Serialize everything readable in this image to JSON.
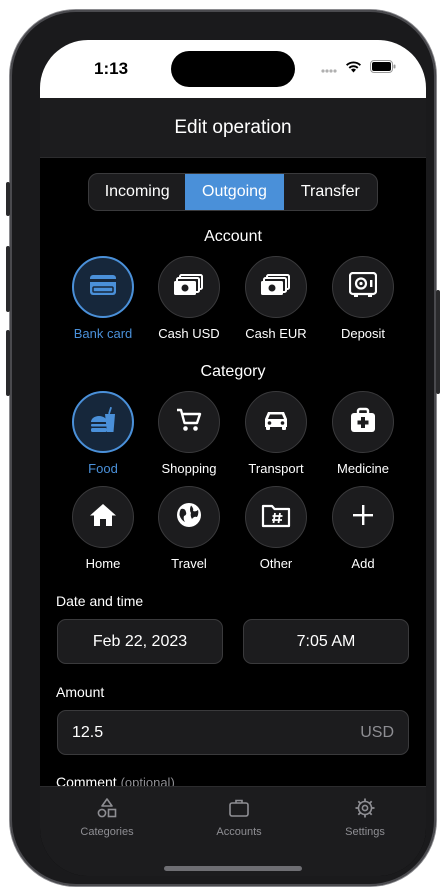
{
  "status_bar": {
    "time": "1:13"
  },
  "nav": {
    "title": "Edit operation"
  },
  "segments": [
    {
      "label": "Incoming",
      "active": false
    },
    {
      "label": "Outgoing",
      "active": true
    },
    {
      "label": "Transfer",
      "active": false
    }
  ],
  "account": {
    "title": "Account",
    "items": [
      {
        "label": "Bank card",
        "icon": "credit-card-icon",
        "selected": true
      },
      {
        "label": "Cash USD",
        "icon": "cash-icon",
        "selected": false
      },
      {
        "label": "Cash EUR",
        "icon": "cash-icon",
        "selected": false
      },
      {
        "label": "Deposit",
        "icon": "safe-icon",
        "selected": false
      }
    ]
  },
  "category": {
    "title": "Category",
    "items": [
      {
        "label": "Food",
        "icon": "fastfood-icon",
        "selected": true
      },
      {
        "label": "Shopping",
        "icon": "cart-icon",
        "selected": false
      },
      {
        "label": "Transport",
        "icon": "car-icon",
        "selected": false
      },
      {
        "label": "Medicine",
        "icon": "medical-bag-icon",
        "selected": false
      },
      {
        "label": "Home",
        "icon": "home-icon",
        "selected": false
      },
      {
        "label": "Travel",
        "icon": "globe-icon",
        "selected": false
      },
      {
        "label": "Other",
        "icon": "folder-hash-icon",
        "selected": false
      },
      {
        "label": "Add",
        "icon": "plus-icon",
        "selected": false
      }
    ]
  },
  "datetime": {
    "label": "Date and time",
    "date": "Feb 22, 2023",
    "time": "7:05 AM"
  },
  "amount": {
    "label": "Amount",
    "value": "12.5",
    "currency": "USD"
  },
  "comment": {
    "label": "Comment",
    "optional": "(optional)"
  },
  "tabs": [
    {
      "label": "Categories",
      "icon": "shapes-icon"
    },
    {
      "label": "Accounts",
      "icon": "briefcase-icon"
    },
    {
      "label": "Settings",
      "icon": "gear-icon"
    }
  ],
  "colors": {
    "accent": "#4a90d9",
    "background": "#000000",
    "surface": "#1c1c1e",
    "secondary_text": "#8e8e93"
  }
}
